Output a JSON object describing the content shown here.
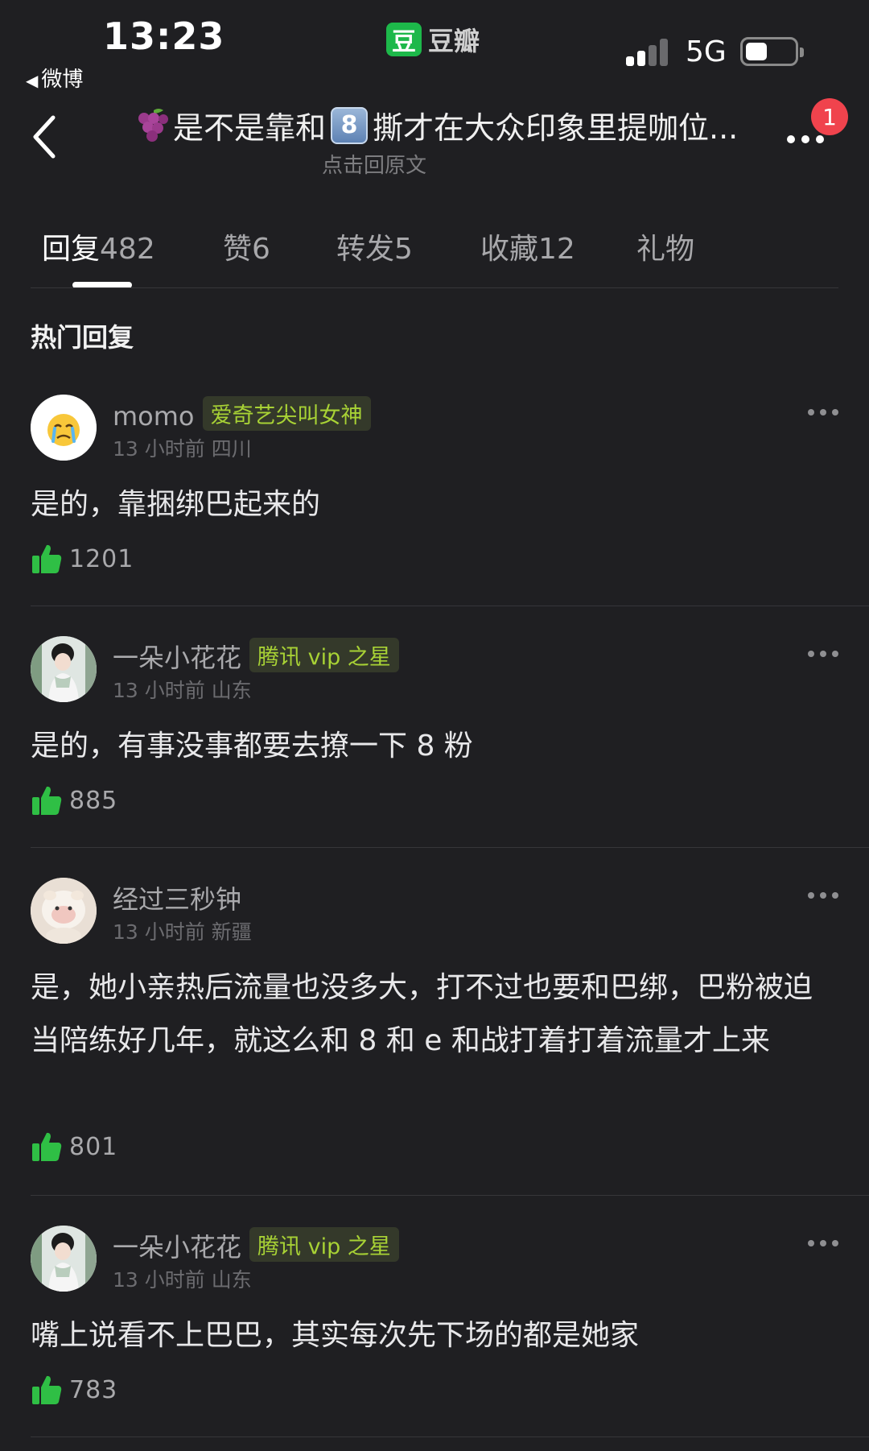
{
  "status_bar": {
    "time": "13:23",
    "back_app": "微博",
    "app_brand_icon": "豆",
    "app_brand_name": "豆瓣",
    "network": "5G",
    "battery_level": 0.45
  },
  "header": {
    "title": "是不是靠和 8 撕才在大众印象里提咖位...",
    "title_prefix_icon": "grape-icon",
    "title_key8": "8",
    "title_part1": "是不是靠和",
    "title_part2": "撕才在大众印象里提咖位...",
    "subtitle": "点击回原文",
    "notification_count": "1"
  },
  "tabs": [
    {
      "label": "回复",
      "count": "482",
      "active": true
    },
    {
      "label": "赞",
      "count": "6",
      "active": false
    },
    {
      "label": "转发",
      "count": "5",
      "active": false
    },
    {
      "label": "收藏",
      "count": "12",
      "active": false
    },
    {
      "label": "礼物",
      "count": "",
      "active": false
    }
  ],
  "section_title": "热门回复",
  "comments": [
    {
      "username": "momo",
      "badge": "爱奇艺尖叫女神",
      "meta": "13 小时前 四川",
      "text": "是的，靠捆绑巴起来的",
      "likes": "1201",
      "avatar": "crying-emoji-avatar"
    },
    {
      "username": "一朵小花花",
      "badge": "腾讯 vip 之星",
      "meta": "13 小时前 山东",
      "text": "是的，有事没事都要去撩一下 8 粉",
      "likes": "885",
      "avatar": "girl-portrait-avatar"
    },
    {
      "username": "经过三秒钟",
      "badge": "",
      "meta": "13 小时前 新疆",
      "text": "是，她小亲热后流量也没多大，打不过也要和巴绑，巴粉被迫当陪练好几年，就这么和 8 和 e 和战打着打着流量才上来",
      "likes": "801",
      "avatar": "plush-toy-avatar"
    },
    {
      "username": "一朵小花花",
      "badge": "腾讯 vip 之星",
      "meta": "13 小时前 山东",
      "text": "嘴上说看不上巴巴，其实每次先下场的都是她家",
      "likes": "783",
      "avatar": "girl-portrait-avatar"
    }
  ],
  "colors": {
    "background": "#1f1f22",
    "badge_bg": "#34392a",
    "badge_text": "#a8d235",
    "like_green": "#2fbf45",
    "notification_red": "#f0434d",
    "brand_green": "#1db84a"
  }
}
